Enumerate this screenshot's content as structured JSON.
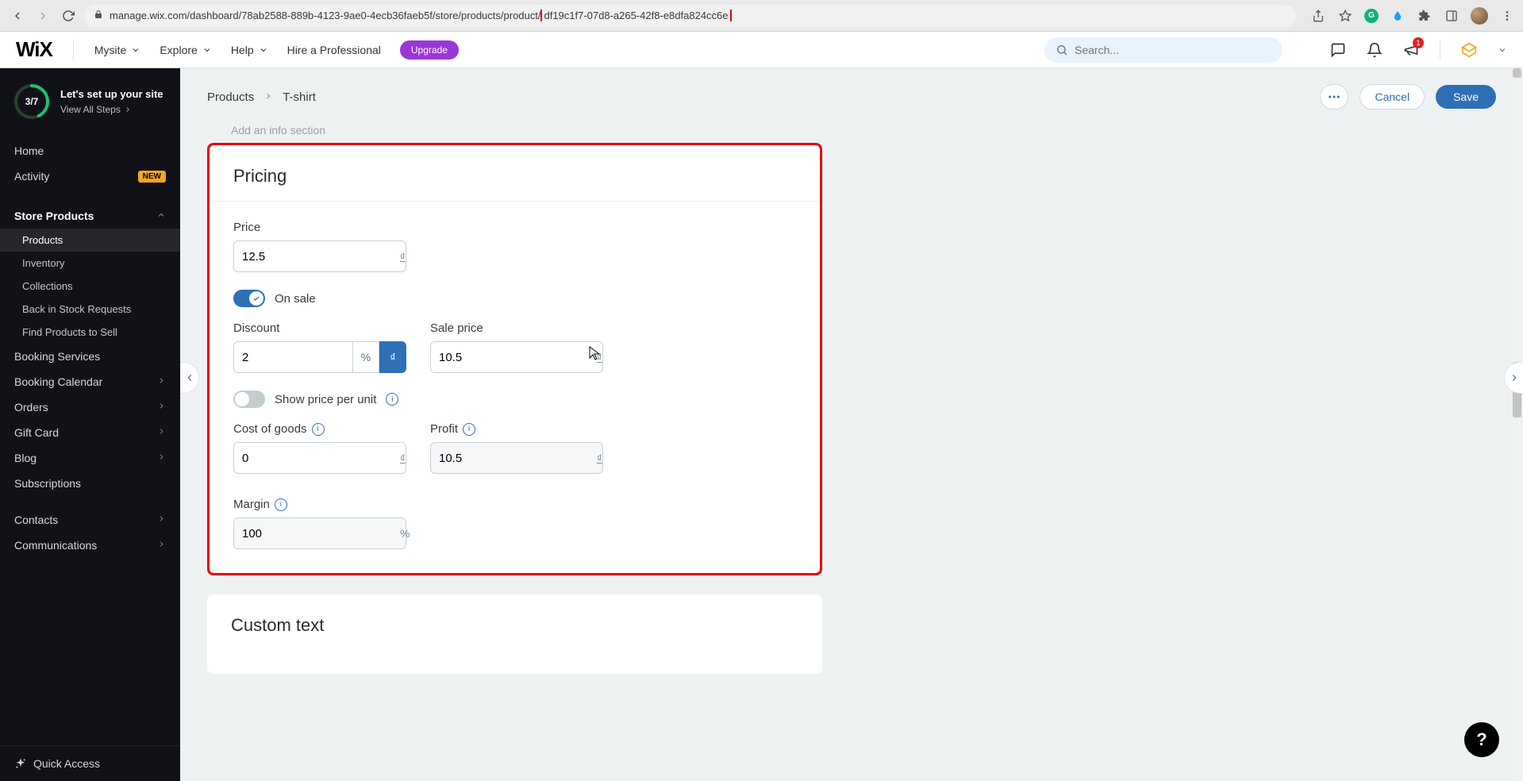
{
  "browser": {
    "url_prefix": "manage.wix.com/dashboard/78ab2588-889b-4123-9ae0-4ecb36faeb5f/store/products/product/",
    "url_highlight": "df19c1f7-07d8-a265-42f8-e8dfa824cc6e",
    "notification_count": "1"
  },
  "appbar": {
    "logo": "WiX",
    "site_label": "Mysite",
    "explore": "Explore",
    "help": "Help",
    "hire": "Hire a Professional",
    "upgrade": "Upgrade",
    "search_placeholder": "Search..."
  },
  "setup": {
    "progress_text": "3/7",
    "title": "Let's set up your site",
    "view_steps": "View All Steps"
  },
  "sidebar": {
    "home": "Home",
    "activity": "Activity",
    "activity_badge": "NEW",
    "store_products": "Store Products",
    "subs": {
      "products": "Products",
      "inventory": "Inventory",
      "collections": "Collections",
      "back_in_stock": "Back in Stock Requests",
      "find_products": "Find Products to Sell"
    },
    "booking_services": "Booking Services",
    "booking_calendar": "Booking Calendar",
    "orders": "Orders",
    "gift_card": "Gift Card",
    "blog": "Blog",
    "subscriptions": "Subscriptions",
    "contacts": "Contacts",
    "communications": "Communications",
    "quick_access": "Quick Access"
  },
  "breadcrumb": {
    "products": "Products",
    "current": "T-shirt"
  },
  "actions": {
    "cancel": "Cancel",
    "save": "Save"
  },
  "ghost_link": "Add an info section",
  "pricing": {
    "title": "Pricing",
    "price_label": "Price",
    "price_value": "12.5",
    "currency_symbol": "₫",
    "on_sale_label": "On sale",
    "on_sale": true,
    "discount_label": "Discount",
    "discount_value": "2",
    "discount_unit_percent": "%",
    "discount_unit_currency": "₫",
    "sale_price_label": "Sale price",
    "sale_price_value": "10.5",
    "show_per_unit_label": "Show price per unit",
    "cost_goods_label": "Cost of goods",
    "cost_goods_value": "0",
    "profit_label": "Profit",
    "profit_value": "10.5",
    "margin_label": "Margin",
    "margin_value": "100",
    "margin_unit": "%"
  },
  "custom_text": {
    "title": "Custom text"
  }
}
